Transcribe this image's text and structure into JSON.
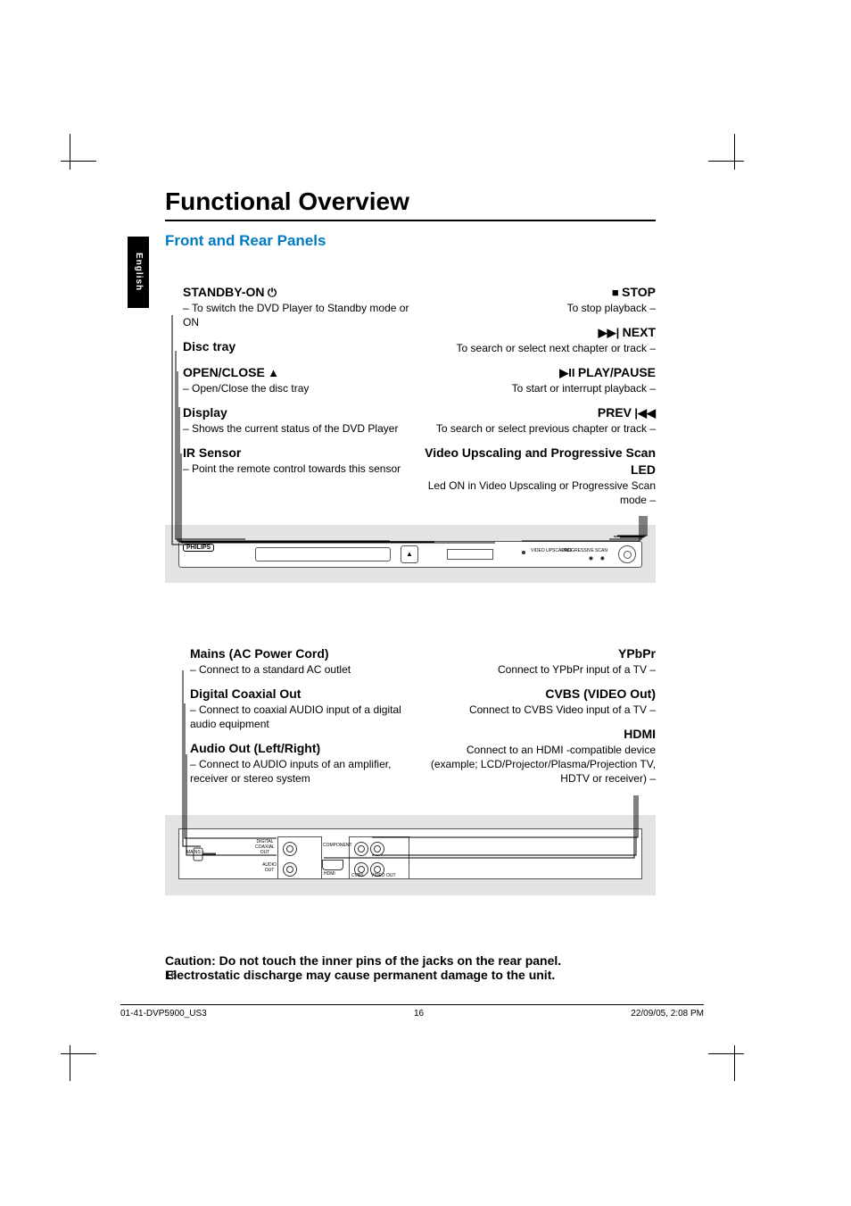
{
  "lang_tab": "English",
  "title": "Functional Overview",
  "section1_head": "Front and Rear Panels",
  "front": {
    "left": [
      {
        "hd": "STANDBY-ON",
        "icon": "⏻",
        "ds": "To switch the DVD Player to Standby mode or ON"
      },
      {
        "hd": "Disc tray",
        "ds": ""
      },
      {
        "hd": "OPEN/CLOSE",
        "icon": "▲",
        "ds": "Open/Close the disc tray"
      },
      {
        "hd": "Display",
        "ds": "Shows the current status of the DVD Player"
      },
      {
        "hd": "IR Sensor",
        "ds": "Point the remote control towards this sensor"
      }
    ],
    "right": [
      {
        "icon": "■",
        "hd": "STOP",
        "ds": "To stop playback"
      },
      {
        "icon": "▶▶|",
        "hd": "NEXT",
        "ds": "To search or select next chapter or track"
      },
      {
        "icon": "▶II",
        "hd": "PLAY/PAUSE",
        "ds": "To start or interrupt playback"
      },
      {
        "hd": "PREV",
        "icon_after": "|◀◀",
        "ds": "To search or select previous chapter or track"
      },
      {
        "hd": "Video Upscaling and Progressive Scan LED",
        "ds": "Led ON in Video Upscaling or Progressive Scan mode"
      }
    ],
    "device": {
      "logo": "PHILIPS",
      "eject_label": "OPEN/CLOSE",
      "lbl_upscale": "VIDEO UPSCALING",
      "lbl_progscan": "PROGRESSIVE SCAN"
    }
  },
  "rear": {
    "left": [
      {
        "hd": "Mains (AC Power Cord)",
        "ds": "Connect to a standard AC outlet"
      },
      {
        "hd": "Digital Coaxial Out",
        "ds": "Connect to coaxial AUDIO input of a digital audio equipment"
      },
      {
        "hd": "Audio Out (Left/Right)",
        "ds": "Connect to AUDIO inputs of an amplifier, receiver or stereo system"
      }
    ],
    "right": [
      {
        "hd": "YPbPr",
        "ds": "Connect to YPbPr input of a TV"
      },
      {
        "hd": "CVBS (VIDEO Out)",
        "ds": "Connect to CVBS Video input of a TV"
      },
      {
        "hd": "HDMI",
        "ds": "Connect to an HDMI -compatible device (example; LCD/Projector/Plasma/Projection TV, HDTV or receiver)"
      }
    ],
    "device": {
      "mains_label": "MAINS ~",
      "coax_label": "DIGITAL COAXIAL OUT",
      "audio_label": "AUDIO OUT",
      "hdmi_label": "HDMI",
      "comp_label": "COMPONENT",
      "cvbs_label": "CVBS",
      "video_label": "VIDEO OUT"
    }
  },
  "caution_l1": "Caution: Do not touch the inner pins of the jacks on the rear panel.",
  "caution_l2": "Electrostatic discharge may cause permanent damage to the unit.",
  "page_number": "16",
  "footer": {
    "file": "01-41-DVP5900_US3",
    "page": "16",
    "timestamp": "22/09/05, 2:08 PM"
  }
}
